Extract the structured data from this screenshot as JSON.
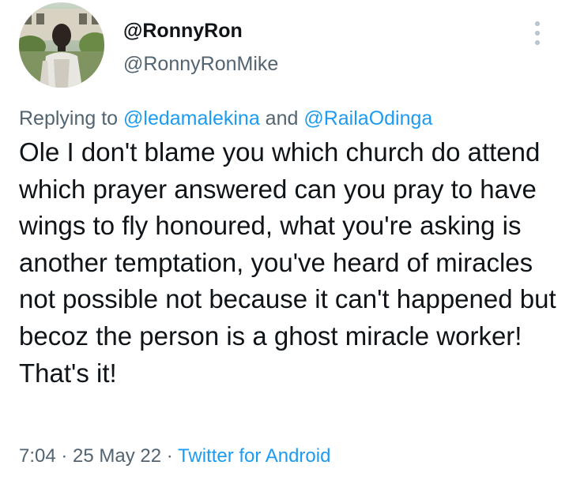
{
  "user": {
    "display_name": "@RonnyRon",
    "handle": "@RonnyRonMike"
  },
  "reply": {
    "prefix": "Replying to ",
    "mention1": "@ledamalekina",
    "joiner": " and ",
    "mention2": "@RailaOdinga"
  },
  "tweet": {
    "text": "Ole I don't blame you which church do attend which prayer answered can you pray to have wings to fly honoured, what you're asking is another temptation, you've heard of miracles not possible not because it can't happened but becoz the person is a ghost miracle worker! That's it!"
  },
  "meta": {
    "time": "7:04",
    "separator": " · ",
    "date": "25 May 22",
    "separator2": " · ",
    "source": "Twitter for Android"
  },
  "colors": {
    "text_primary": "#0f1419",
    "text_secondary": "#536471",
    "link": "#1d9bf0"
  },
  "icons": {
    "more": "more-vertical-icon"
  }
}
